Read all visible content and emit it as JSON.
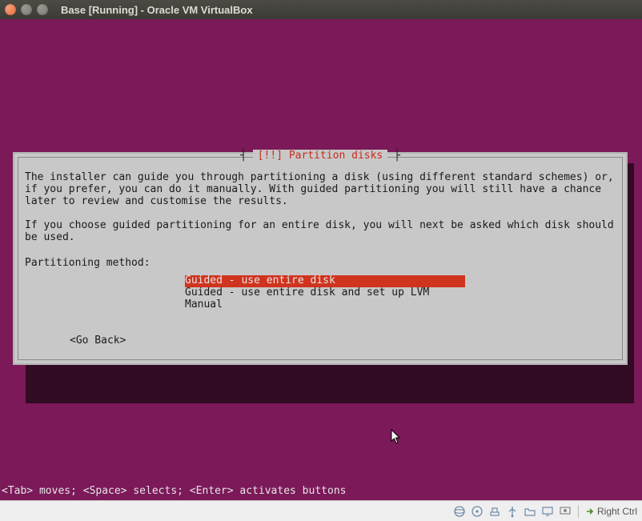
{
  "window": {
    "title": "Base [Running] - Oracle VM VirtualBox"
  },
  "dialog": {
    "title": "[!!] Partition disks",
    "body": "The installer can guide you through partitioning a disk (using different standard schemes) or, if you prefer, you can do it manually. With guided partitioning you will still have a chance later to review and customise the results.\n\nIf you choose guided partitioning for an entire disk, you will next be asked which disk should be used.",
    "prompt": "Partitioning method:",
    "options": [
      "Guided - use entire disk",
      "Guided - use entire disk and set up LVM",
      "Manual"
    ],
    "selected_index": 0,
    "go_back": "<Go Back>"
  },
  "hint": "<Tab> moves; <Space> selects; <Enter> activates buttons",
  "statusbar": {
    "host_key": "Right Ctrl"
  },
  "icons": {
    "disk": "disk-icon",
    "cd": "cd-icon",
    "net": "net-icon",
    "usb": "usb-icon",
    "shared": "shared-folder-icon",
    "display": "display-icon",
    "capture": "capture-icon",
    "hostkey": "hostkey-arrow-icon"
  }
}
